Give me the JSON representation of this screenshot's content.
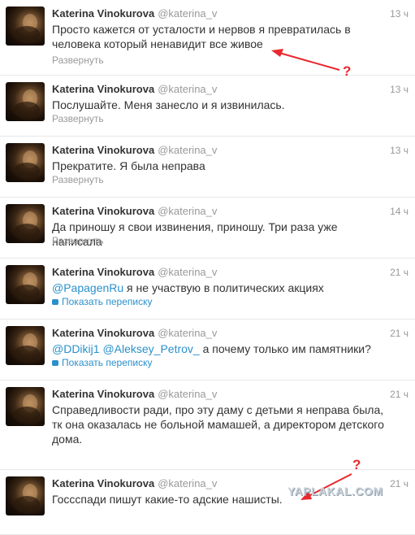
{
  "tweets": [
    {
      "name": "Katerina Vinokurova",
      "handle": "@katerina_v",
      "time": "13 ч",
      "parts": [
        {
          "t": "Просто кажется от усталости и нервов я превратилась в человека который ненавидит все живое"
        }
      ],
      "action": "Развернуть",
      "action_type": "expand"
    },
    {
      "name": "Katerina Vinokurova",
      "handle": "@katerina_v",
      "time": "13 ч",
      "parts": [
        {
          "t": "Послушайте. Меня занесло и я извинилась."
        }
      ],
      "action": "Развернуть",
      "action_type": "expand"
    },
    {
      "name": "Katerina Vinokurova",
      "handle": "@katerina_v",
      "time": "13 ч",
      "parts": [
        {
          "t": "Прекратите. Я была неправа"
        }
      ],
      "action": "Развернуть",
      "action_type": "expand"
    },
    {
      "name": "Katerina Vinokurova",
      "handle": "@katerina_v",
      "time": "14 ч",
      "parts": [
        {
          "t": "Да приношу я свои извинения, приношу. Три раза уже написала"
        }
      ],
      "action": "Развернуть",
      "action_type": "expand"
    },
    {
      "name": "Katerina Vinokurova",
      "handle": "@katerina_v",
      "time": "21 ч",
      "parts": [
        {
          "t": "@PapagenRu",
          "m": true
        },
        {
          "t": " я не участвую в политических акциях"
        }
      ],
      "action": "Показать переписку",
      "action_type": "conversation"
    },
    {
      "name": "Katerina Vinokurova",
      "handle": "@katerina_v",
      "time": "21 ч",
      "parts": [
        {
          "t": "@DDikij1",
          "m": true
        },
        {
          "t": " "
        },
        {
          "t": "@Aleksey_Petrov_",
          "m": true
        },
        {
          "t": " а почему только им памятники?"
        }
      ],
      "action": "Показать переписку",
      "action_type": "conversation"
    },
    {
      "name": "Katerina Vinokurova",
      "handle": "@katerina_v",
      "time": "21 ч",
      "parts": [
        {
          "t": "Справедливости ради, про эту даму с детьми я неправа была, тк она оказалась не больной мамашей, а директором детского дома."
        }
      ],
      "action": "",
      "action_type": "none"
    },
    {
      "name": "Katerina Vinokurova",
      "handle": "@katerina_v",
      "time": "21 ч",
      "parts": [
        {
          "t": "Госсспади пишут какие-то адские нашисты."
        }
      ],
      "action": "",
      "action_type": "none"
    }
  ],
  "annotations": {
    "question_mark": "?",
    "arrow_color": "#e8282e"
  },
  "watermark": "YAPLAKAL.COM",
  "colors": {
    "link": "#2a90cc",
    "muted": "#999999",
    "text": "#333333",
    "border": "#e8e8e8"
  }
}
